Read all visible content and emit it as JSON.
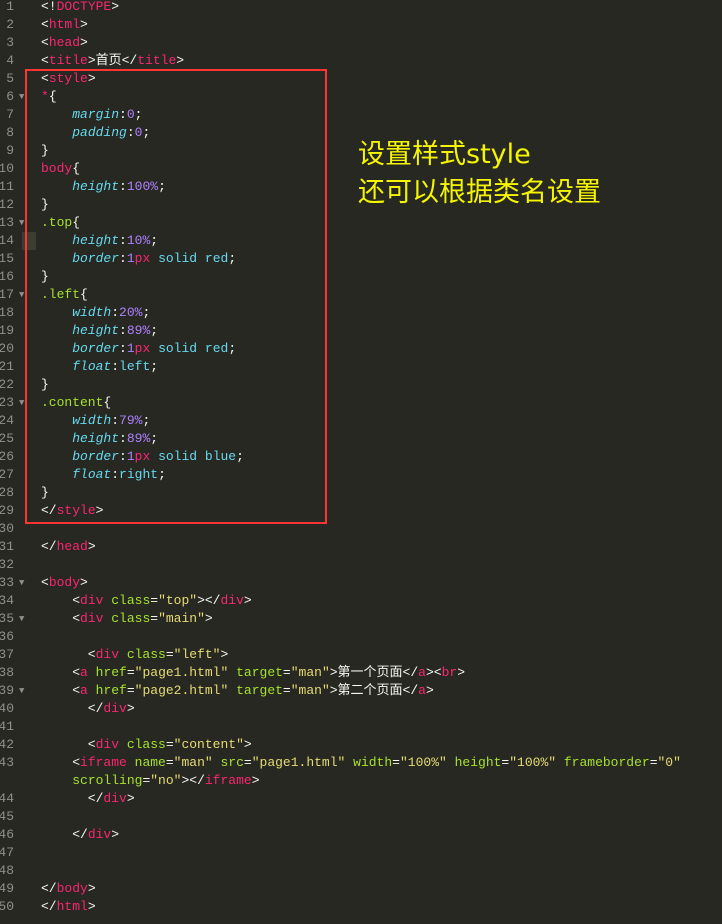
{
  "editor": {
    "colors": {
      "background": "#272822",
      "tag": "#f92672",
      "attr": "#a6e22e",
      "string": "#e6db74",
      "property": "#66d9ef",
      "number": "#ae81ff",
      "annotation": "#f5f500",
      "highlight_box": "#ff3535"
    },
    "highlighted_line": 14,
    "folded_lines": [
      6,
      13,
      17,
      23,
      33,
      35,
      39
    ],
    "lines": [
      {
        "n": "1",
        "tk": [
          [
            "p",
            "<!"
          ],
          [
            "t",
            "DOCTYPE"
          ],
          [
            "p",
            ">"
          ]
        ]
      },
      {
        "n": "2",
        "tk": [
          [
            "p",
            "<"
          ],
          [
            "t",
            "html"
          ],
          [
            "p",
            ">"
          ]
        ]
      },
      {
        "n": "3",
        "tk": [
          [
            "p",
            "<"
          ],
          [
            "t",
            "head"
          ],
          [
            "p",
            ">"
          ]
        ]
      },
      {
        "n": "4",
        "tk": [
          [
            "p",
            "<"
          ],
          [
            "t",
            "title"
          ],
          [
            "p",
            ">首页</"
          ],
          [
            "t",
            "title"
          ],
          [
            "p",
            ">"
          ]
        ]
      },
      {
        "n": "5",
        "tk": [
          [
            "p",
            "<"
          ],
          [
            "t",
            "style"
          ],
          [
            "p",
            ">"
          ]
        ]
      },
      {
        "n": "6",
        "tk": [
          [
            "t",
            "*"
          ],
          [
            "p",
            "{"
          ]
        ]
      },
      {
        "n": "7",
        "tk": [
          [
            "p",
            "    "
          ],
          [
            "k",
            "margin"
          ],
          [
            "p",
            ":"
          ],
          [
            "n",
            "0"
          ],
          [
            "p",
            ";"
          ]
        ]
      },
      {
        "n": "8",
        "tk": [
          [
            "p",
            "    "
          ],
          [
            "k",
            "padding"
          ],
          [
            "p",
            ":"
          ],
          [
            "n",
            "0"
          ],
          [
            "p",
            ";"
          ]
        ]
      },
      {
        "n": "9",
        "tk": [
          [
            "p",
            "}"
          ]
        ]
      },
      {
        "n": "10",
        "tk": [
          [
            "t",
            "body"
          ],
          [
            "p",
            "{"
          ]
        ]
      },
      {
        "n": "11",
        "tk": [
          [
            "p",
            "    "
          ],
          [
            "k",
            "height"
          ],
          [
            "p",
            ":"
          ],
          [
            "n",
            "100%"
          ],
          [
            "p",
            ";"
          ]
        ]
      },
      {
        "n": "12",
        "tk": [
          [
            "p",
            "}"
          ]
        ]
      },
      {
        "n": "13",
        "tk": [
          [
            "a",
            ".top"
          ],
          [
            "p",
            "{"
          ]
        ]
      },
      {
        "n": "14",
        "tk": [
          [
            "p",
            "    "
          ],
          [
            "k",
            "height"
          ],
          [
            "p",
            ":"
          ],
          [
            "n",
            "10%"
          ],
          [
            "p",
            ";"
          ]
        ]
      },
      {
        "n": "15",
        "tk": [
          [
            "p",
            "    "
          ],
          [
            "k",
            "border"
          ],
          [
            "p",
            ":"
          ],
          [
            "n",
            "1"
          ],
          [
            "u",
            "px"
          ],
          [
            "p",
            " "
          ],
          [
            "c",
            "solid"
          ],
          [
            "p",
            " "
          ],
          [
            "c",
            "red"
          ],
          [
            "p",
            ";"
          ]
        ]
      },
      {
        "n": "16",
        "tk": [
          [
            "p",
            "}"
          ]
        ]
      },
      {
        "n": "17",
        "tk": [
          [
            "a",
            ".left"
          ],
          [
            "p",
            "{"
          ]
        ]
      },
      {
        "n": "18",
        "tk": [
          [
            "p",
            "    "
          ],
          [
            "k",
            "width"
          ],
          [
            "p",
            ":"
          ],
          [
            "n",
            "20%"
          ],
          [
            "p",
            ";"
          ]
        ]
      },
      {
        "n": "19",
        "tk": [
          [
            "p",
            "    "
          ],
          [
            "k",
            "height"
          ],
          [
            "p",
            ":"
          ],
          [
            "n",
            "89%"
          ],
          [
            "p",
            ";"
          ]
        ]
      },
      {
        "n": "20",
        "tk": [
          [
            "p",
            "    "
          ],
          [
            "k",
            "border"
          ],
          [
            "p",
            ":"
          ],
          [
            "n",
            "1"
          ],
          [
            "u",
            "px"
          ],
          [
            "p",
            " "
          ],
          [
            "c",
            "solid"
          ],
          [
            "p",
            " "
          ],
          [
            "c",
            "red"
          ],
          [
            "p",
            ";"
          ]
        ]
      },
      {
        "n": "21",
        "tk": [
          [
            "p",
            "    "
          ],
          [
            "k",
            "float"
          ],
          [
            "p",
            ":"
          ],
          [
            "c",
            "left"
          ],
          [
            "p",
            ";"
          ]
        ]
      },
      {
        "n": "22",
        "tk": [
          [
            "p",
            "}"
          ]
        ]
      },
      {
        "n": "23",
        "tk": [
          [
            "a",
            ".content"
          ],
          [
            "p",
            "{"
          ]
        ]
      },
      {
        "n": "24",
        "tk": [
          [
            "p",
            "    "
          ],
          [
            "k",
            "width"
          ],
          [
            "p",
            ":"
          ],
          [
            "n",
            "79%"
          ],
          [
            "p",
            ";"
          ]
        ]
      },
      {
        "n": "25",
        "tk": [
          [
            "p",
            "    "
          ],
          [
            "k",
            "height"
          ],
          [
            "p",
            ":"
          ],
          [
            "n",
            "89%"
          ],
          [
            "p",
            ";"
          ]
        ]
      },
      {
        "n": "26",
        "tk": [
          [
            "p",
            "    "
          ],
          [
            "k",
            "border"
          ],
          [
            "p",
            ":"
          ],
          [
            "n",
            "1"
          ],
          [
            "u",
            "px"
          ],
          [
            "p",
            " "
          ],
          [
            "c",
            "solid"
          ],
          [
            "p",
            " "
          ],
          [
            "c",
            "blue"
          ],
          [
            "p",
            ";"
          ]
        ]
      },
      {
        "n": "27",
        "tk": [
          [
            "p",
            "    "
          ],
          [
            "k",
            "float"
          ],
          [
            "p",
            ":"
          ],
          [
            "c",
            "right"
          ],
          [
            "p",
            ";"
          ]
        ]
      },
      {
        "n": "28",
        "tk": [
          [
            "p",
            "}"
          ]
        ]
      },
      {
        "n": "29",
        "tk": [
          [
            "p",
            "</"
          ],
          [
            "t",
            "style"
          ],
          [
            "p",
            ">"
          ]
        ]
      },
      {
        "n": "30",
        "tk": []
      },
      {
        "n": "31",
        "tk": [
          [
            "p",
            "</"
          ],
          [
            "t",
            "head"
          ],
          [
            "p",
            ">"
          ]
        ]
      },
      {
        "n": "32",
        "tk": []
      },
      {
        "n": "33",
        "tk": [
          [
            "p",
            "<"
          ],
          [
            "t",
            "body"
          ],
          [
            "p",
            ">"
          ]
        ]
      },
      {
        "n": "34",
        "tk": [
          [
            "p",
            "    <"
          ],
          [
            "t",
            "div"
          ],
          [
            "p",
            " "
          ],
          [
            "a",
            "class"
          ],
          [
            "p",
            "="
          ],
          [
            "s",
            "\"top\""
          ],
          [
            "p",
            "></"
          ],
          [
            "t",
            "div"
          ],
          [
            "p",
            ">"
          ]
        ]
      },
      {
        "n": "35",
        "tk": [
          [
            "p",
            "    <"
          ],
          [
            "t",
            "div"
          ],
          [
            "p",
            " "
          ],
          [
            "a",
            "class"
          ],
          [
            "p",
            "="
          ],
          [
            "s",
            "\"main\""
          ],
          [
            "p",
            ">"
          ]
        ]
      },
      {
        "n": "36",
        "tk": []
      },
      {
        "n": "37",
        "tk": [
          [
            "p",
            "      <"
          ],
          [
            "t",
            "div"
          ],
          [
            "p",
            " "
          ],
          [
            "a",
            "class"
          ],
          [
            "p",
            "="
          ],
          [
            "s",
            "\"left\""
          ],
          [
            "p",
            ">"
          ]
        ]
      },
      {
        "n": "38",
        "tk": [
          [
            "p",
            "    <"
          ],
          [
            "t",
            "a"
          ],
          [
            "p",
            " "
          ],
          [
            "a",
            "href"
          ],
          [
            "p",
            "="
          ],
          [
            "s",
            "\"page1.html\""
          ],
          [
            "p",
            " "
          ],
          [
            "a",
            "target"
          ],
          [
            "p",
            "="
          ],
          [
            "s",
            "\"man\""
          ],
          [
            "p",
            ">第一个页面</"
          ],
          [
            "t",
            "a"
          ],
          [
            "p",
            "><"
          ],
          [
            "t",
            "br"
          ],
          [
            "p",
            ">"
          ]
        ]
      },
      {
        "n": "39",
        "tk": [
          [
            "p",
            "    <"
          ],
          [
            "t",
            "a"
          ],
          [
            "p",
            " "
          ],
          [
            "a",
            "href"
          ],
          [
            "p",
            "="
          ],
          [
            "s",
            "\"page2.html\""
          ],
          [
            "p",
            " "
          ],
          [
            "a",
            "target"
          ],
          [
            "p",
            "="
          ],
          [
            "s",
            "\"man\""
          ],
          [
            "p",
            ">第二个页面</"
          ],
          [
            "t",
            "a"
          ],
          [
            "p",
            ">"
          ]
        ]
      },
      {
        "n": "40",
        "tk": [
          [
            "p",
            "      </"
          ],
          [
            "t",
            "div"
          ],
          [
            "p",
            ">"
          ]
        ]
      },
      {
        "n": "41",
        "tk": []
      },
      {
        "n": "42",
        "tk": [
          [
            "p",
            "      <"
          ],
          [
            "t",
            "div"
          ],
          [
            "p",
            " "
          ],
          [
            "a",
            "class"
          ],
          [
            "p",
            "="
          ],
          [
            "s",
            "\"content\""
          ],
          [
            "p",
            ">"
          ]
        ]
      },
      {
        "n": "43",
        "tk": [
          [
            "p",
            "    <"
          ],
          [
            "t",
            "iframe"
          ],
          [
            "p",
            " "
          ],
          [
            "a",
            "name"
          ],
          [
            "p",
            "="
          ],
          [
            "s",
            "\"man\""
          ],
          [
            "p",
            " "
          ],
          [
            "a",
            "src"
          ],
          [
            "p",
            "="
          ],
          [
            "s",
            "\"page1.html\""
          ],
          [
            "p",
            " "
          ],
          [
            "a",
            "width"
          ],
          [
            "p",
            "="
          ],
          [
            "s",
            "\"100%\""
          ],
          [
            "p",
            " "
          ],
          [
            "a",
            "height"
          ],
          [
            "p",
            "="
          ],
          [
            "s",
            "\"100%\""
          ],
          [
            "p",
            " "
          ],
          [
            "a",
            "frameborder"
          ],
          [
            "p",
            "="
          ],
          [
            "s",
            "\"0\""
          ]
        ]
      },
      {
        "n": "",
        "tk": [
          [
            "p",
            "    "
          ],
          [
            "a",
            "scrolling"
          ],
          [
            "p",
            "="
          ],
          [
            "s",
            "\"no\""
          ],
          [
            "p",
            "></"
          ],
          [
            "t",
            "iframe"
          ],
          [
            "p",
            ">"
          ]
        ]
      },
      {
        "n": "44",
        "tk": [
          [
            "p",
            "      </"
          ],
          [
            "t",
            "div"
          ],
          [
            "p",
            ">"
          ]
        ]
      },
      {
        "n": "45",
        "tk": []
      },
      {
        "n": "46",
        "tk": [
          [
            "p",
            "    </"
          ],
          [
            "t",
            "div"
          ],
          [
            "p",
            ">"
          ]
        ]
      },
      {
        "n": "47",
        "tk": []
      },
      {
        "n": "48",
        "tk": []
      },
      {
        "n": "49",
        "tk": [
          [
            "p",
            "</"
          ],
          [
            "t",
            "body"
          ],
          [
            "p",
            ">"
          ]
        ]
      },
      {
        "n": "50",
        "tk": [
          [
            "p",
            "</"
          ],
          [
            "t",
            "html"
          ],
          [
            "p",
            ">"
          ]
        ]
      }
    ]
  },
  "annotation": {
    "line1": "设置样式style",
    "line2": "还可以根据类名设置"
  }
}
